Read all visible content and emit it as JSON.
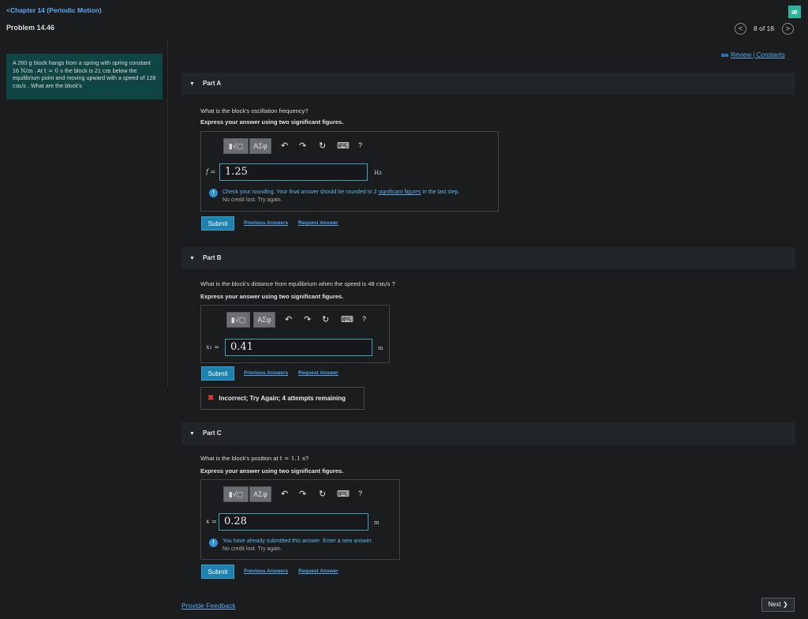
{
  "header": {
    "breadcrumb": "<Chapter 14 (Periodic Motion)",
    "problem_title": "Problem 14.46",
    "logo_text": "æ",
    "counter": "8 of 18",
    "prev_label": "<",
    "next_label": ">"
  },
  "problem": {
    "text_1": "A 260 ",
    "unit_g": "g",
    "text_2": " block hangs from a spring with spring constant 16 ",
    "unit_nm": "N/m",
    "text_3": " . At ",
    "t_eq": "t = 0 s",
    "text_4": " the block is 21 ",
    "unit_cm": "cm",
    "text_5": " below the equilibrium point and moving upward with a speed of 128 ",
    "unit_cms": "cm/s",
    "text_6": " . What are the block's"
  },
  "review_link": "Review | Constants",
  "toolbar": {
    "templates_label": "▮√▢",
    "symbols_label": "ΑΣφ",
    "undo_icon": "↶",
    "redo_icon": "↷",
    "reset_icon": "↻",
    "keyboard_label": "⌨",
    "help_label": "?"
  },
  "parts": {
    "a": {
      "header": "Part A",
      "question": "What is the block's oscillation frequency?",
      "instruction": "Express your answer using two significant figures.",
      "var_label": "f =",
      "value": "1.25",
      "unit": "Hz",
      "feedback_main_1": "Check your rounding. Your final answer should be rounded to 2 ",
      "feedback_link": "significant figures",
      "feedback_main_2": " in the last step.",
      "feedback_sub": "No credit lost. Try again.",
      "submit": "Submit",
      "prev_answers": "Previous Answers",
      "request_answer": "Request Answer"
    },
    "b": {
      "header": "Part B",
      "question_1": "What is the block's distance from equilibrium when the speed is 48 ",
      "question_unit": "cm/s",
      "question_2": " ?",
      "instruction": "Express your answer using two significant figures.",
      "var_label": "x₁ =",
      "value": "0.41",
      "unit": "m",
      "submit": "Submit",
      "prev_answers": "Previous Answers",
      "request_answer": "Request Answer",
      "incorrect_icon": "✖",
      "incorrect": "Incorrect; Try Again; 4 attempts remaining"
    },
    "c": {
      "header": "Part C",
      "question_1": "What is the block's position at ",
      "question_eq": "t = 1.1 s",
      "question_2": "?",
      "instruction": "Express your answer using two significant figures.",
      "var_label": "x =",
      "value": "0.28",
      "unit": "m",
      "feedback_main": "You have already submitted this answer. Enter a new answer.",
      "feedback_sub": "No credit lost. Try again.",
      "submit": "Submit",
      "prev_answers": "Previous Answers",
      "request_answer": "Request Answer"
    }
  },
  "footer": {
    "provide_feedback": "Provide Feedback",
    "next": "Next ❯"
  },
  "colors": {
    "background": "#1a1c1e",
    "problem_box": "#0f4543",
    "link": "#5aa9f0",
    "submit": "#1e82b0",
    "incorrect": "#e23b3b",
    "logo": "#2bb59a"
  }
}
